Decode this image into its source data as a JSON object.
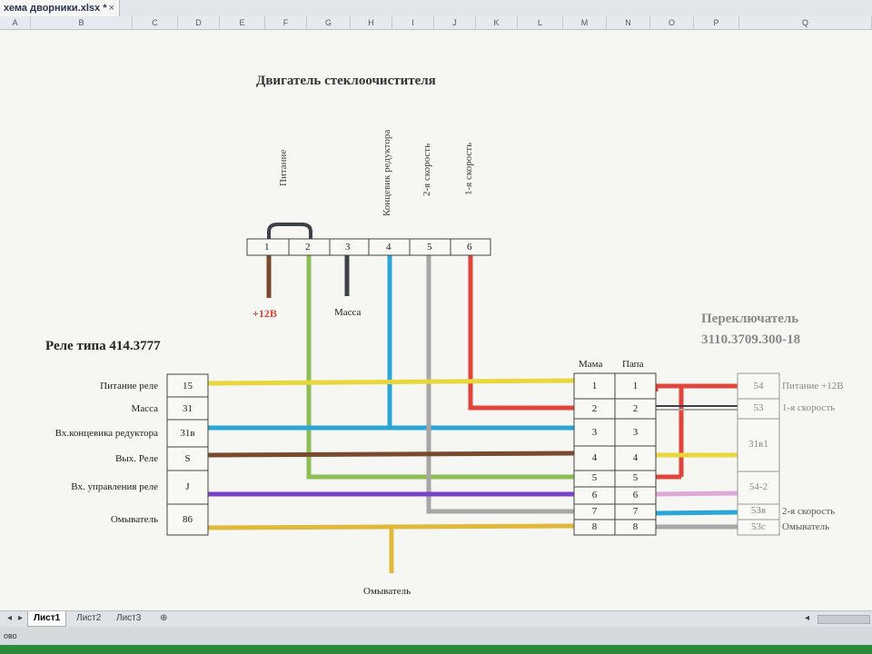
{
  "window": {
    "doc_tab": "хема дворники.xlsx *",
    "close_glyph": "×"
  },
  "columns": [
    "A",
    "B",
    "C",
    "D",
    "E",
    "F",
    "G",
    "H",
    "I",
    "J",
    "K",
    "L",
    "M",
    "N",
    "O",
    "P",
    "Q"
  ],
  "motor": {
    "title": "Двигатель стеклоочистителя",
    "pins": [
      "1",
      "2",
      "3",
      "4",
      "5",
      "6"
    ],
    "labels": [
      "Питание",
      "Концевик редуктора",
      "2-я скорость",
      "1-я скорость"
    ],
    "plus12": "+12В",
    "massa": "Масса"
  },
  "relay": {
    "title": "Реле типа  414.3777",
    "rows": [
      {
        "label": "Питание реле",
        "pin": "15"
      },
      {
        "label": "Масса",
        "pin": "31"
      },
      {
        "label": "Вх.концевика редуктора",
        "pin": "31в"
      },
      {
        "label": "Вых. Реле",
        "pin": "S"
      },
      {
        "label": "Вх. управления реле",
        "pin": "J"
      },
      {
        "label": "Омыватель",
        "pin": "86"
      }
    ]
  },
  "connector": {
    "mama": "Мама",
    "papa": "Папа",
    "pins": [
      "1",
      "2",
      "3",
      "4",
      "5",
      "6",
      "7",
      "8"
    ]
  },
  "switch": {
    "title1": "Переключатель",
    "title2": "3110.3709.300-18",
    "pins": [
      "54",
      "53",
      "31в1",
      "54-2",
      "53в",
      "53с"
    ],
    "right_labels": [
      "Питание +12В",
      "1-я скорость",
      "2-я скорость",
      "Омыватель"
    ]
  },
  "washer_label": "Омыватель",
  "sheets": [
    "Лист1",
    "Лист2",
    "Лист3"
  ],
  "status": "ово",
  "colors": {
    "yellow": "#e8d63a",
    "brown": "#7a4a2e",
    "green": "#8cbf55",
    "blue": "#2aa6d6",
    "gray": "#a8a6a6",
    "red": "#e0443a",
    "purple": "#7c3fc8",
    "orange": "#e0b83a",
    "dark": "#3c4248",
    "pink": "#e0a8d8",
    "black": "#333333"
  }
}
